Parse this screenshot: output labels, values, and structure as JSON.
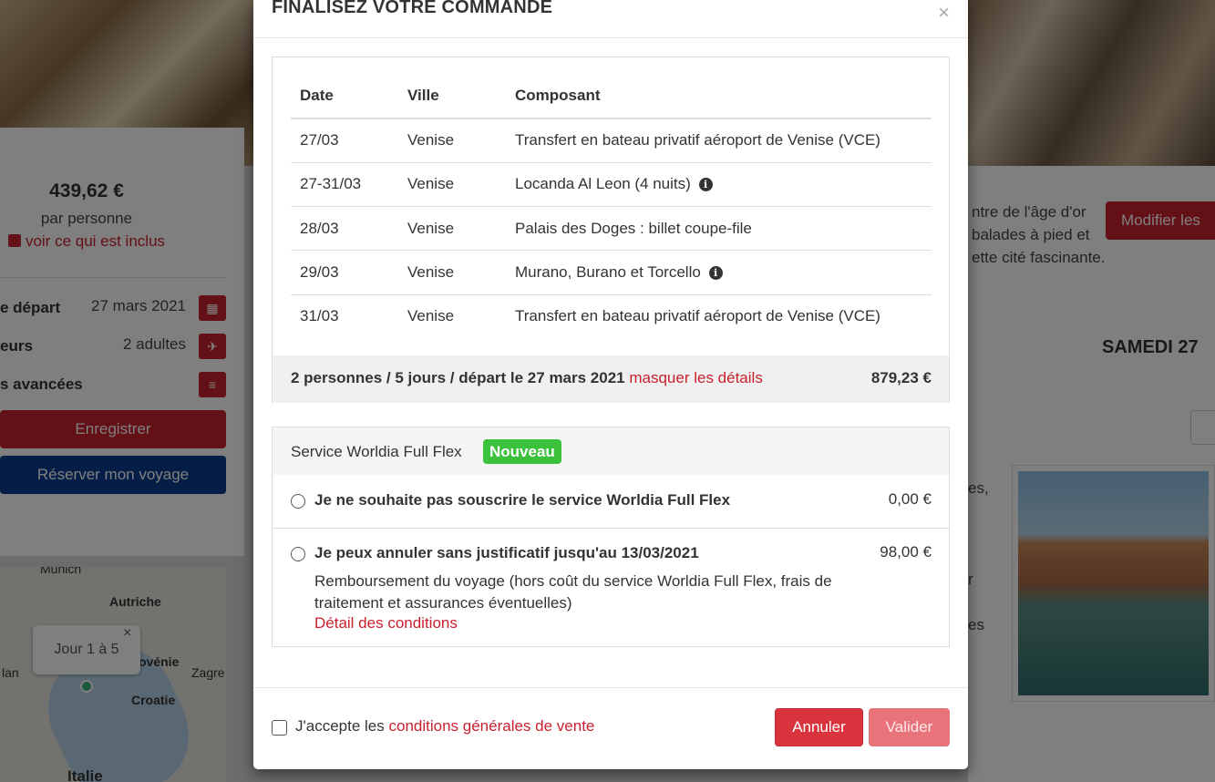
{
  "background": {
    "price": "439,62 €",
    "per_person": "par personne",
    "included_link": "voir ce qui est inclus",
    "rows": [
      {
        "label": "e départ",
        "value": "27 mars 2021",
        "icon": "calendar-icon"
      },
      {
        "label": "eurs",
        "value": "2 adultes",
        "icon": "traveler-icon"
      },
      {
        "label": "s avancées",
        "value": "",
        "icon": "sliders-icon"
      }
    ],
    "save_button": "Enregistrer",
    "book_button": "Réserver mon voyage",
    "map": {
      "tooltip": "Jour 1 à 5",
      "tooltip_close": "×",
      "labels": [
        "Munich",
        "Autriche",
        "ovénie",
        "Zagre",
        "lan",
        "Croatie",
        "Italie"
      ]
    },
    "right_text": "ntre de l'âge d'or balades à pied et ette cité fascinante.",
    "modify_button": "Modifier les",
    "day_heading": "SAMEDI 27",
    "fragments": [
      "es,",
      "r",
      "es"
    ]
  },
  "modal": {
    "title": "FINALISEZ VOTRE COMMANDE",
    "close": "×",
    "table": {
      "headers": [
        "Date",
        "Ville",
        "Composant"
      ],
      "rows": [
        {
          "date": "27/03",
          "city": "Venise",
          "component": "Transfert en bateau privatif aéroport de Venise (VCE)",
          "info": false
        },
        {
          "date": "27-31/03",
          "city": "Venise",
          "component": "Locanda Al Leon (4 nuits)",
          "info": true
        },
        {
          "date": "28/03",
          "city": "Venise",
          "component": "Palais des Doges : billet coupe-file",
          "info": false
        },
        {
          "date": "29/03",
          "city": "Venise",
          "component": "Murano, Burano et Torcello",
          "info": true
        },
        {
          "date": "31/03",
          "city": "Venise",
          "component": "Transfert en bateau privatif aéroport de Venise (VCE)",
          "info": false
        }
      ]
    },
    "summary": {
      "text": "2 personnes / 5 jours / départ le 27 mars 2021",
      "toggle_link": "masquer les détails",
      "total": "879,23 €"
    },
    "flex": {
      "title": "Service Worldia Full Flex",
      "badge": "Nouveau",
      "options": [
        {
          "label": "Je ne souhaite pas souscrire le service Worldia Full Flex",
          "price": "0,00 €"
        },
        {
          "label": "Je peux annuler sans justificatif jusqu'au 13/03/2021",
          "price": "98,00 €",
          "description": "Remboursement du voyage (hors coût du service Worldia Full Flex, frais de traitement et assurances éventuelles)",
          "link": "Détail des conditions"
        }
      ]
    },
    "footer": {
      "accept_text": "J'accepte les",
      "accept_link": "conditions générales de vente",
      "cancel": "Annuler",
      "validate": "Valider"
    }
  },
  "colors": {
    "accent": "#c9202f",
    "navy": "#0b3d91",
    "badge": "#3cc13c"
  }
}
